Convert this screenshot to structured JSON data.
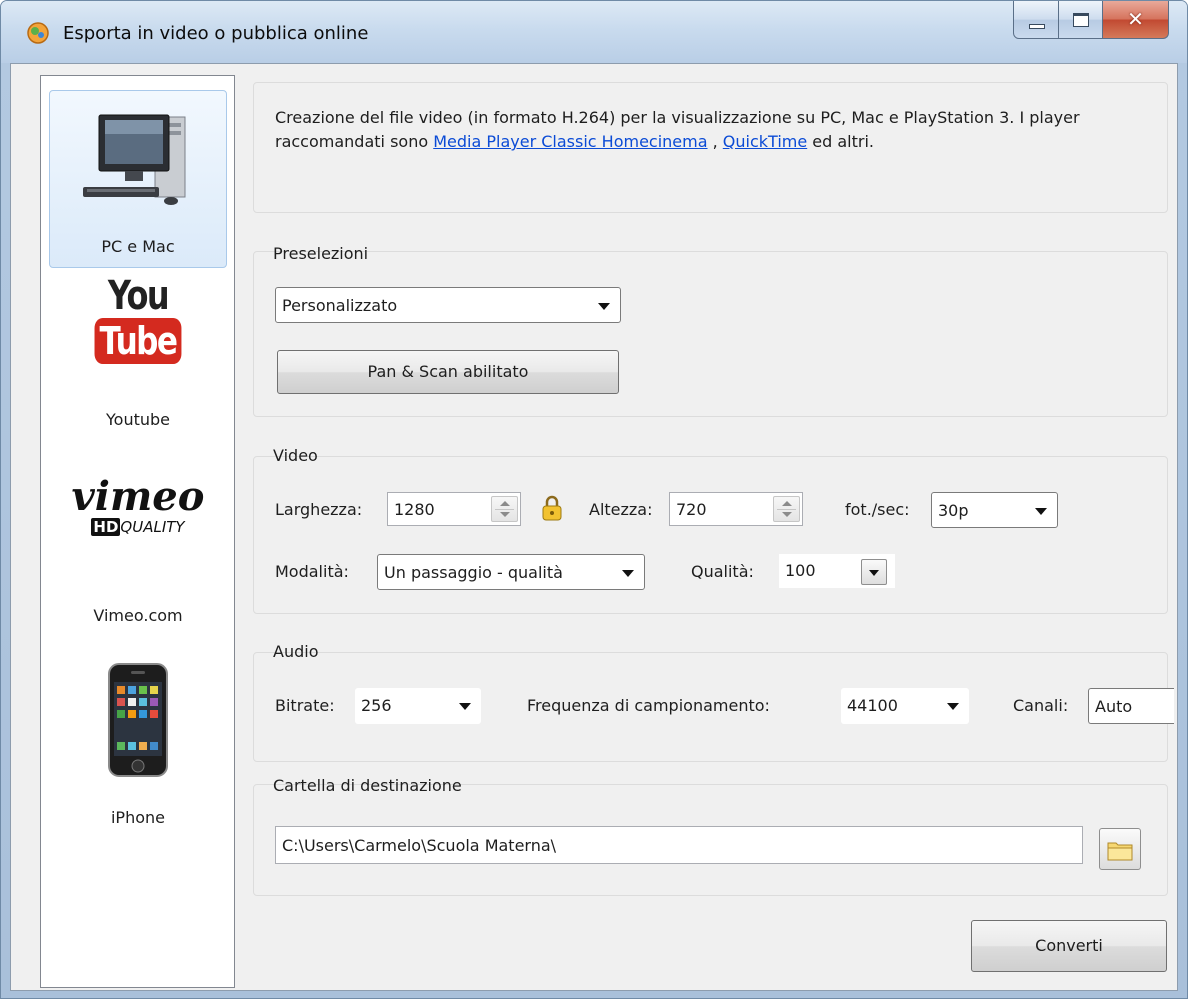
{
  "window": {
    "title": "Esporta in video o pubblica online"
  },
  "sidebar": {
    "items": [
      {
        "label": "PC e Mac",
        "icon": "desktop-computer-icon"
      },
      {
        "label": "Youtube",
        "icon": "youtube-logo"
      },
      {
        "label": "Vimeo.com",
        "icon": "vimeo-logo"
      },
      {
        "label": "iPhone",
        "icon": "iphone-icon"
      }
    ],
    "youtube_logo": {
      "top": "You",
      "bottom": "Tube"
    },
    "vimeo_logo": {
      "word": "vimeo",
      "hd": "HD",
      "quality": "QUALITY"
    }
  },
  "description": {
    "text1": "Creazione del file video (in formato H.264) per la visualizzazione su PC, Mac e PlayStation 3. I player raccomandati sono",
    "link1": "Media Player Classic Homecinema",
    "sep": " ,",
    "link2": "QuickTime",
    "text2": " ed altri."
  },
  "presets": {
    "title": "Preselezioni",
    "selected": "Personalizzato",
    "pan_scan_button": "Pan & Scan abilitato"
  },
  "video": {
    "title": "Video",
    "width_label": "Larghezza:",
    "width_value": "1280",
    "height_label": "Altezza:",
    "height_value": "720",
    "fps_label": "fot./sec:",
    "fps_value": "30p",
    "mode_label": "Modalità:",
    "mode_value": "Un passaggio - qualità",
    "quality_label": "Qualità:",
    "quality_value": "100"
  },
  "audio": {
    "title": "Audio",
    "bitrate_label": "Bitrate:",
    "bitrate_value": "256",
    "freq_label": "Frequenza di campionamento:",
    "freq_value": "44100",
    "channels_label": "Canali:",
    "channels_value": "Auto"
  },
  "destination": {
    "title": "Cartella di destinazione",
    "path": "C:\\Users\\Carmelo\\Scuola Materna\\"
  },
  "convert_button": "Converti",
  "colors": {
    "link": "#0b4bd6",
    "selection_bg": "#dbeaf9",
    "youtube_red": "#d42a1f"
  }
}
